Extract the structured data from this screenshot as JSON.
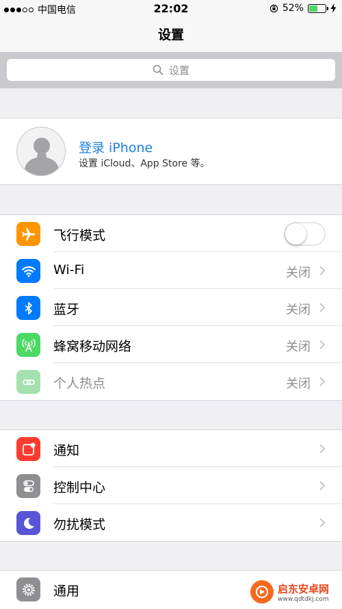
{
  "status_bar": {
    "carrier": "中国电信",
    "time": "22:02",
    "battery_percent": "52%",
    "battery_level": 0.52,
    "signal_filled": 3,
    "signal_total": 5
  },
  "nav": {
    "title": "设置"
  },
  "search": {
    "placeholder": "设置"
  },
  "profile": {
    "title": "登录 iPhone",
    "subtitle": "设置 iCloud、App Store 等。"
  },
  "section1": [
    {
      "label": "飞行模式",
      "icon": "airplane-icon",
      "color": "#ff9500",
      "toggle": false
    },
    {
      "label": "Wi-Fi",
      "icon": "wifi-icon",
      "color": "#007aff",
      "value": "关闭"
    },
    {
      "label": "蓝牙",
      "icon": "bluetooth-icon",
      "color": "#007aff",
      "value": "关闭"
    },
    {
      "label": "蜂窝移动网络",
      "icon": "cellular-icon",
      "color": "#4cd964",
      "value": "关闭"
    },
    {
      "label": "个人热点",
      "icon": "hotspot-icon",
      "color": "#a5e0ae",
      "value": "关闭",
      "dimmed": true
    }
  ],
  "section2": [
    {
      "label": "通知",
      "icon": "notifications-icon",
      "color": "#ff3b30"
    },
    {
      "label": "控制中心",
      "icon": "control-center-icon",
      "color": "#8e8e93"
    },
    {
      "label": "勿扰模式",
      "icon": "moon-icon",
      "color": "#5856d6"
    }
  ],
  "section3": [
    {
      "label": "通用",
      "icon": "gear-icon",
      "color": "#8e8e93"
    }
  ],
  "watermark": {
    "title": "启东安卓网",
    "url": "www.qdtdkj.com"
  }
}
